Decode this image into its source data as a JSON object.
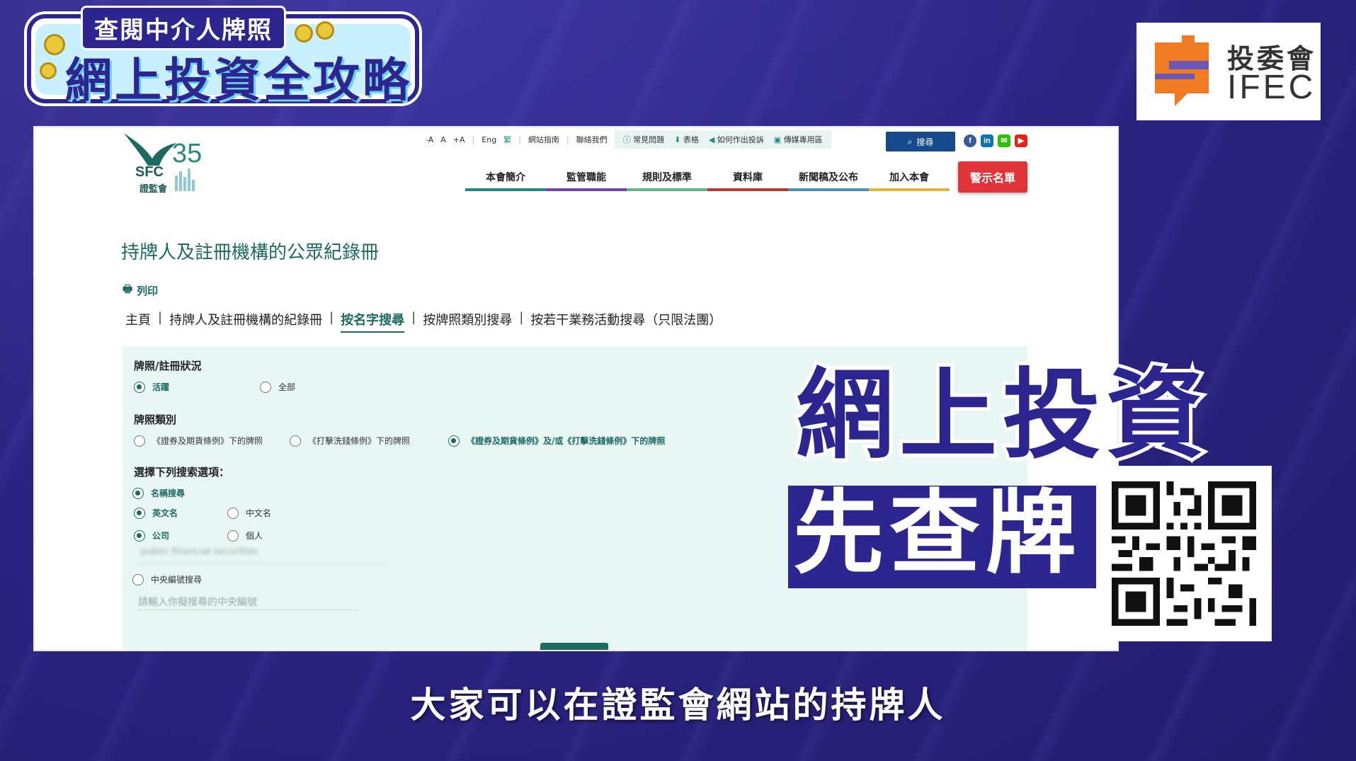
{
  "badge": {
    "top_text": "查閱中介人牌照",
    "main_text": "網上投資全攻略"
  },
  "ifec": {
    "cn": "投委會",
    "en": "IFEC"
  },
  "sfc": {
    "logo_en": "SFC",
    "logo_cn": "證監會",
    "logo_anniv": "35",
    "utility": {
      "font_small": "-A",
      "font_normal": "A",
      "font_large": "+A",
      "lang_eng": "Eng",
      "lang_trad": "繁",
      "sitemap": "網站指南",
      "contact": "聯絡我們",
      "faq": "常見問題",
      "forms": "表格",
      "complaint": "如何作出投訴",
      "media": "傳媒專用區"
    },
    "search_label": "搜尋",
    "nav": [
      {
        "label": "本會簡介",
        "color": "#1d8a7e"
      },
      {
        "label": "監管職能",
        "color": "#7b3fa0"
      },
      {
        "label": "規則及標準",
        "color": "#5fb88a"
      },
      {
        "label": "資料庫",
        "color": "#b83a2b"
      },
      {
        "label": "新聞稿及公布",
        "color": "#4a90b8"
      },
      {
        "label": "加入本會",
        "color": "#e3b43c"
      }
    ],
    "warning_button": "警示名單",
    "page_title": "持牌人及註冊機構的公眾紀錄冊",
    "print_label": "列印",
    "breadcrumb": [
      "主頁",
      "持牌人及註冊機構的紀錄冊",
      "按名字搜尋",
      "按牌照類別搜尋",
      "按若干業務活動搜尋（只限法團）"
    ],
    "form": {
      "status_label": "牌照/註冊狀況",
      "status_active": "活躍",
      "status_all": "全部",
      "type_label": "牌照類別",
      "type_sfo": "《證券及期貨條例》下的牌照",
      "type_amlo": "《打擊洗錢條例》下的牌照",
      "type_both": "《證券及期貨條例》及/或《打擊洗錢條例》下的牌照",
      "search_option_label": "選擇下列搜索選項：",
      "name_search": "名稱搜尋",
      "english_name": "英文名",
      "chinese_name": "中文名",
      "company": "公司",
      "individual": "個人",
      "name_input_value": "public financial securities",
      "ce_search": "中央編號搜尋",
      "ce_placeholder": "請輸入你擬搜尋的中央編號"
    }
  },
  "overlay": {
    "line1": "網上投資",
    "line2": "先查牌"
  },
  "subtitle": "大家可以在證監會網站的持牌人"
}
